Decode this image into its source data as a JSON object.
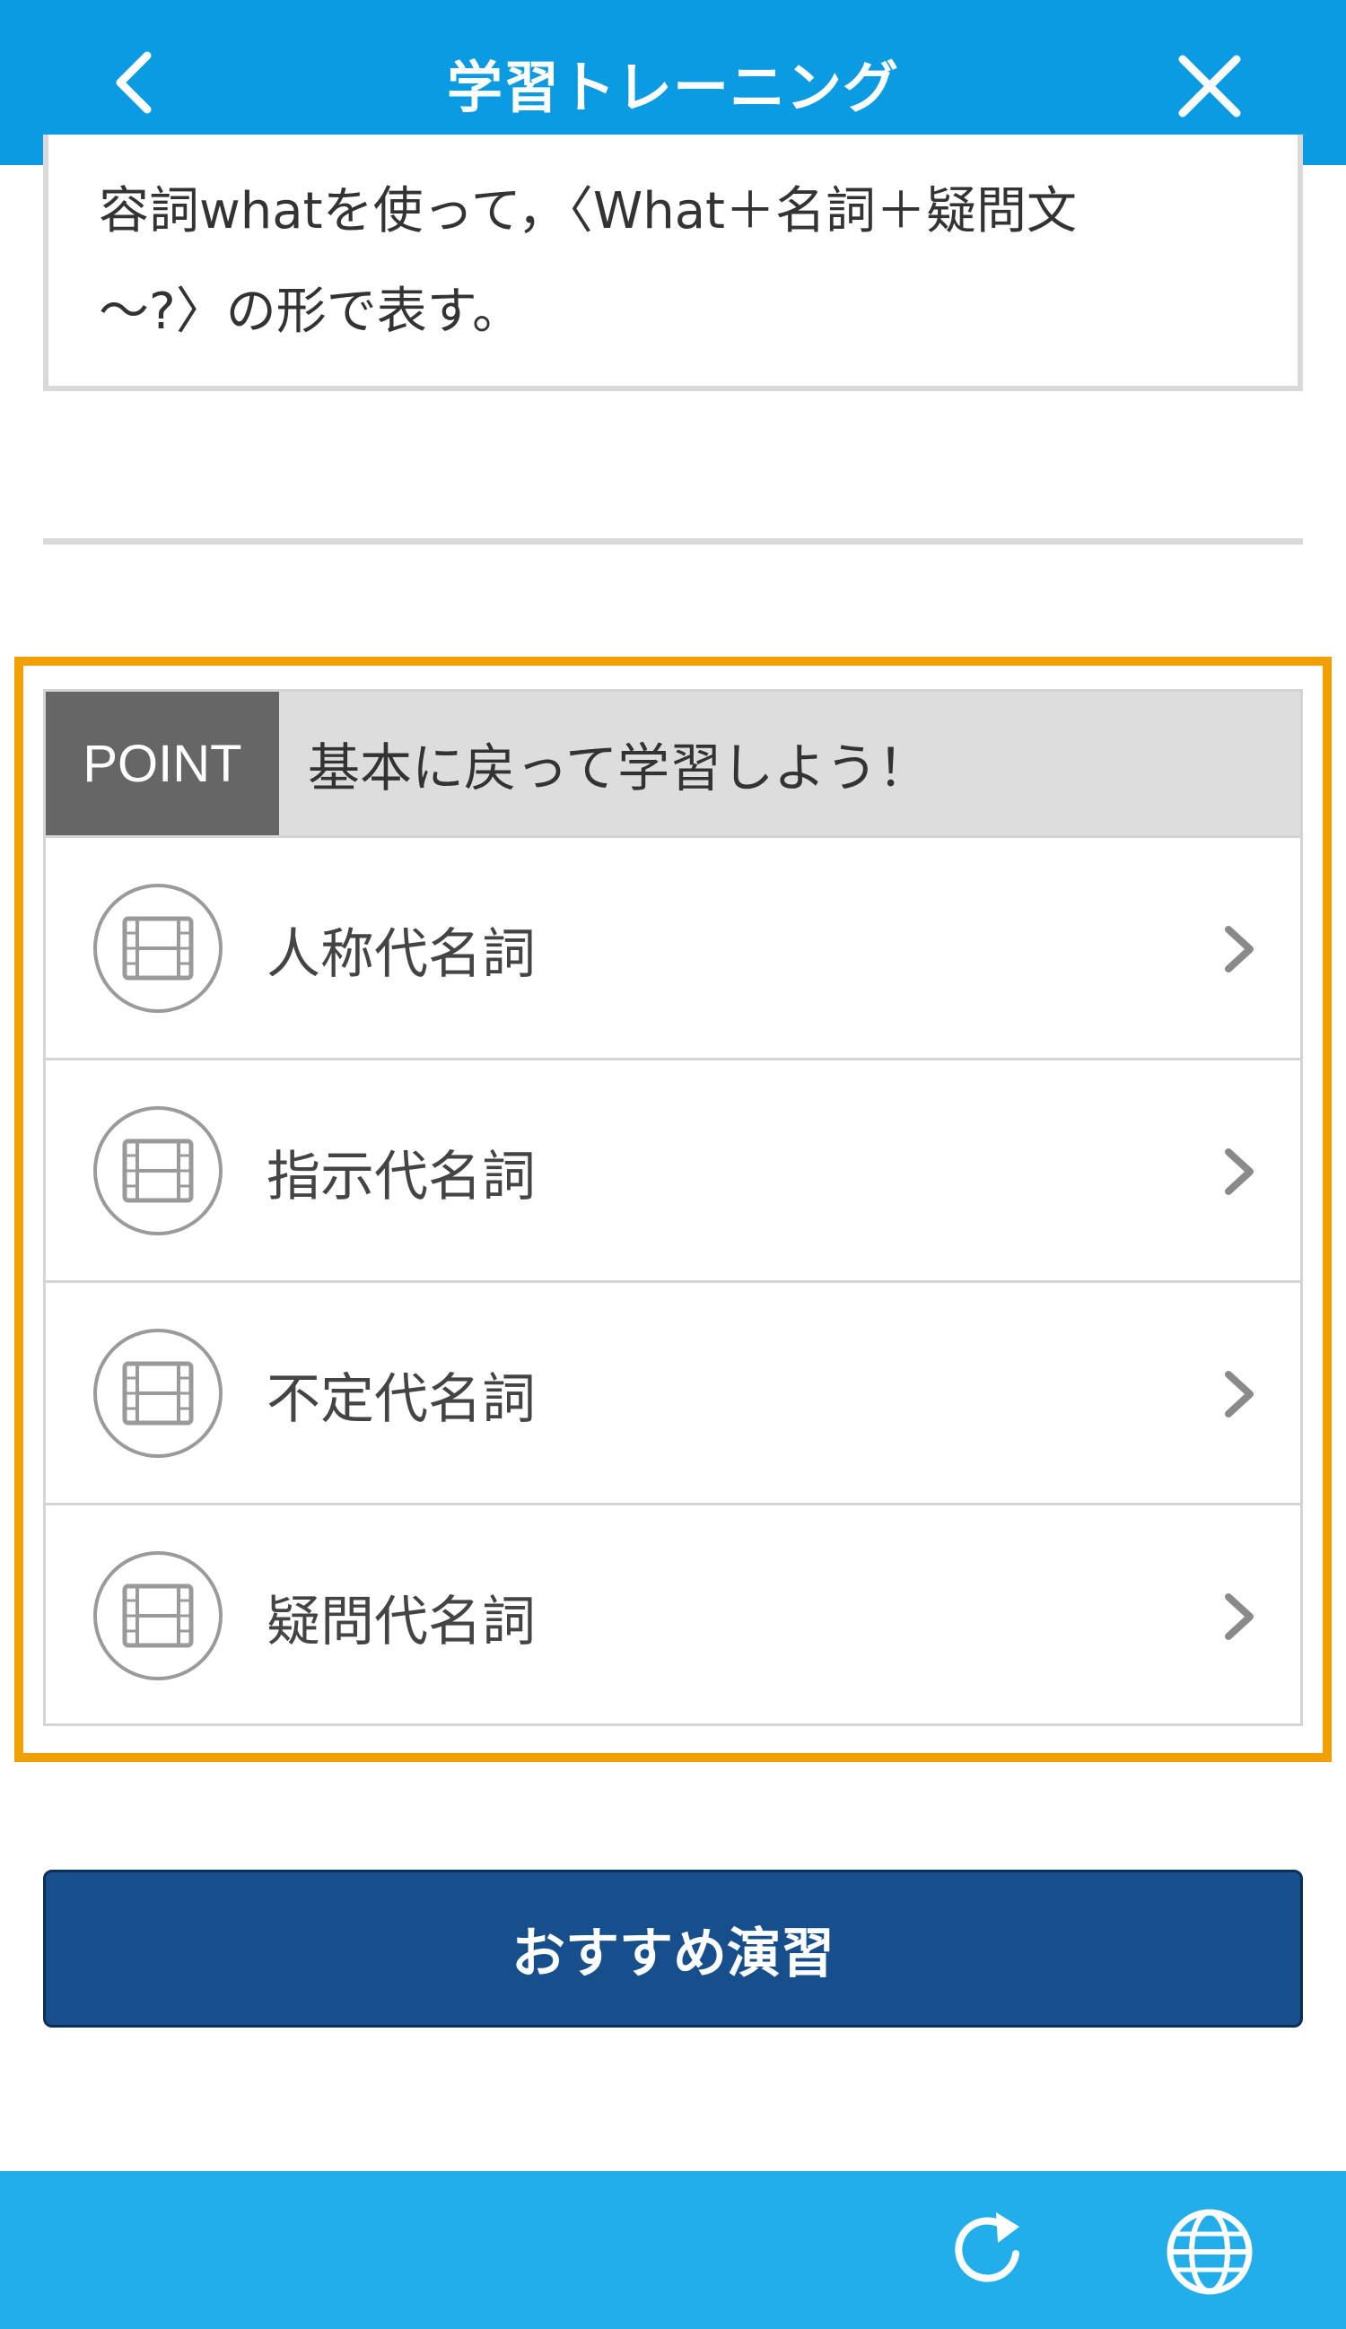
{
  "header": {
    "title": "学習トレーニング",
    "back_icon": "chevron-left-icon",
    "close_icon": "close-icon"
  },
  "explanation": {
    "line1": "容詞whatを使って，〈What＋名詞＋疑問文",
    "line2": "〜?〉の形で表す。"
  },
  "point": {
    "badge": "POINT",
    "heading": "基本に戻って学習しよう！",
    "items": [
      {
        "label": "人称代名詞",
        "icon": "video-film-icon"
      },
      {
        "label": "指示代名詞",
        "icon": "video-film-icon"
      },
      {
        "label": "不定代名詞",
        "icon": "video-film-icon"
      },
      {
        "label": "疑問代名詞",
        "icon": "video-film-icon"
      }
    ]
  },
  "recommend_button": {
    "label": "おすすめ演習"
  },
  "footer": {
    "refresh_icon": "refresh-icon",
    "globe_icon": "globe-icon"
  },
  "colors": {
    "header_bg": "#0b9be3",
    "footer_bg": "#22aeea",
    "highlight_border": "#f0a000",
    "point_badge_bg": "#666666",
    "button_bg": "#174f8c"
  }
}
